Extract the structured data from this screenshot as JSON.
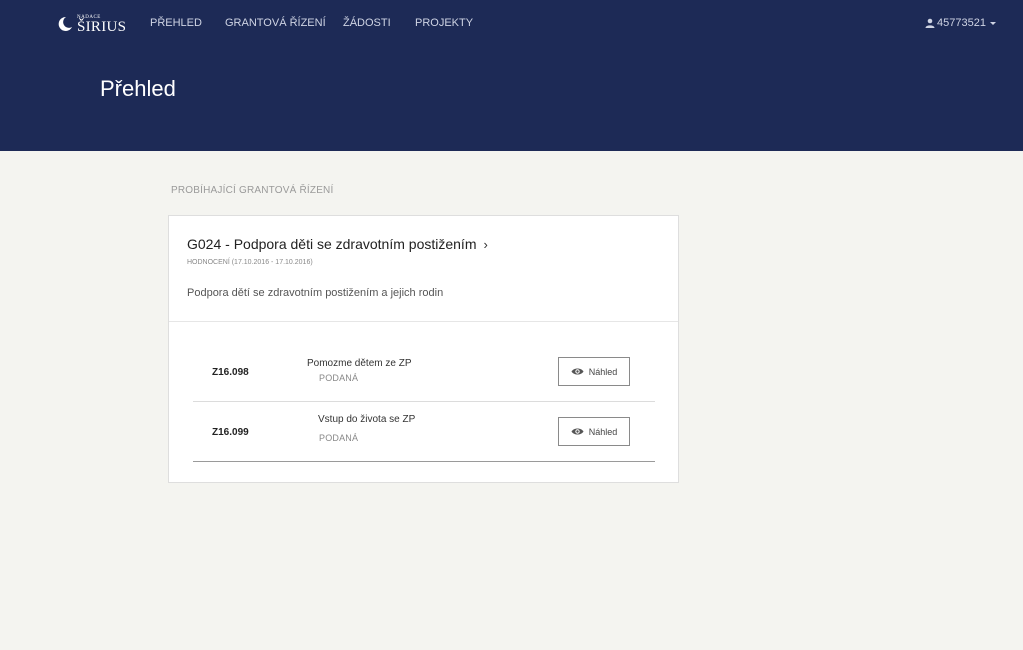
{
  "brand": {
    "small_text": "NADACE",
    "big_text": "ŠIRIUS"
  },
  "nav": {
    "items": [
      "PŘEHLED",
      "GRANTOVÁ ŘÍZENÍ",
      "ŽÁDOSTI",
      "PROJEKTY"
    ]
  },
  "user": {
    "id": "45773521",
    "icon": "user-icon",
    "caret": "caret-down-icon"
  },
  "page": {
    "title": "Přehled"
  },
  "section": {
    "label": "PROBÍHAJÍCÍ GRANTOVÁ ŘÍZENÍ"
  },
  "grant": {
    "title": "G024 - Podpora děti se zdravotním postižením",
    "chevron": "›",
    "phase": "HODNOCENÍ (17.10.2016 - 17.10.2016)",
    "description": "Podpora dětí se zdravotním postižením a jejich rodin",
    "applications": [
      {
        "code": "Z16.098",
        "name": "Pomozme dětem ze ZP",
        "status": "PODANÁ",
        "button": "Náhled"
      },
      {
        "code": "Z16.099",
        "name": "Vstup do života se ZP",
        "status": "PODANÁ",
        "button": "Náhled"
      }
    ]
  },
  "colors": {
    "header_bg": "#1d2a56",
    "page_bg": "#f4f4f0",
    "card_bg": "#ffffff"
  }
}
